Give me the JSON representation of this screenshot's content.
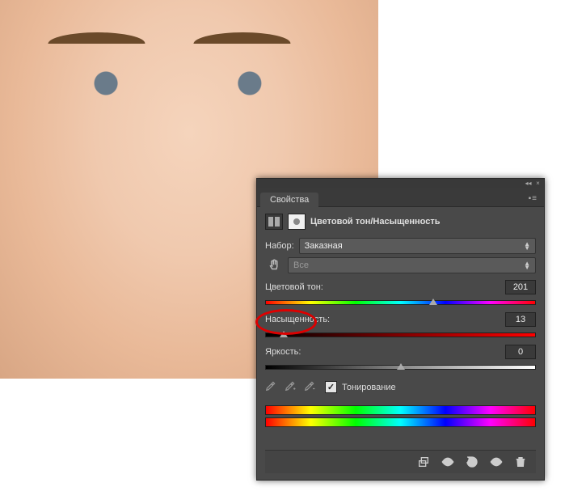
{
  "panel": {
    "tab": "Свойства",
    "title": "Цветовой тон/Насыщенность",
    "preset": {
      "label": "Набор:",
      "value": "Заказная"
    },
    "channel": {
      "value": "Все"
    },
    "sliders": {
      "hue": {
        "label": "Цветовой тон:",
        "value": "201",
        "pos": 62
      },
      "saturation": {
        "label": "Насыщенность:",
        "value": "13",
        "pos": 7
      },
      "lightness": {
        "label": "Яркость:",
        "value": "0",
        "pos": 50
      }
    },
    "colorize": {
      "label": "Тонирование",
      "checked": true
    }
  }
}
